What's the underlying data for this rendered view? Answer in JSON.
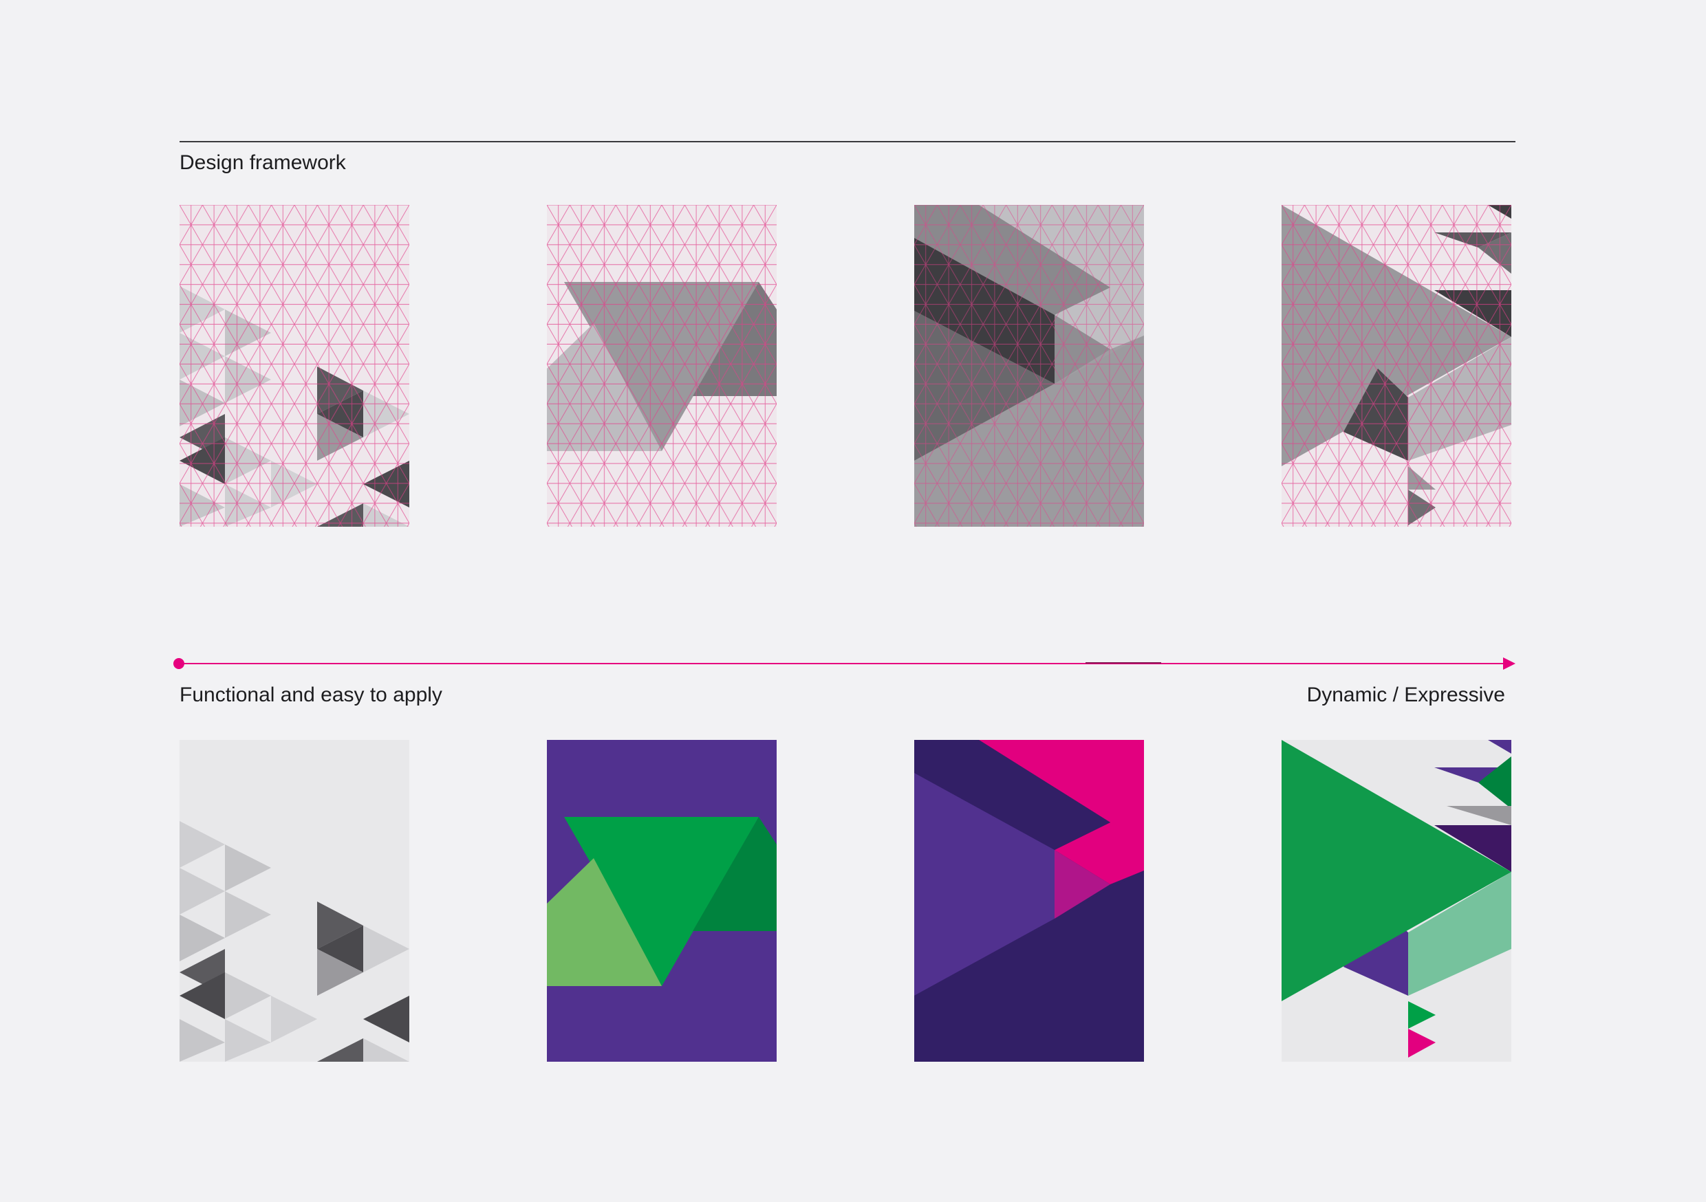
{
  "heading": "Design framework",
  "scale": {
    "left_label": "Functional and easy to apply",
    "right_label": "Dynamic / Expressive",
    "line_color": "#e6007e"
  },
  "colors": {
    "background": "#f2f2f4",
    "grid_paper": "#efe7ec",
    "grid_line": "#e23f8a",
    "gray_light": "#cfcfd2",
    "gray_mid": "#9a999d",
    "gray_dark": "#5b5a5e",
    "gray_darkest": "#3e3d41",
    "purple": "#51318f",
    "deep_purple": "#321f66",
    "green": "#00a047",
    "dark_green": "#00833e",
    "light_green": "#72b963",
    "mint": "#76c29d",
    "magenta": "#e2007f"
  },
  "panels": [
    {
      "row": "framework",
      "index": 1
    },
    {
      "row": "framework",
      "index": 2
    },
    {
      "row": "framework",
      "index": 3
    },
    {
      "row": "framework",
      "index": 4
    },
    {
      "row": "applied",
      "index": 1
    },
    {
      "row": "applied",
      "index": 2
    },
    {
      "row": "applied",
      "index": 3
    },
    {
      "row": "applied",
      "index": 4
    }
  ]
}
